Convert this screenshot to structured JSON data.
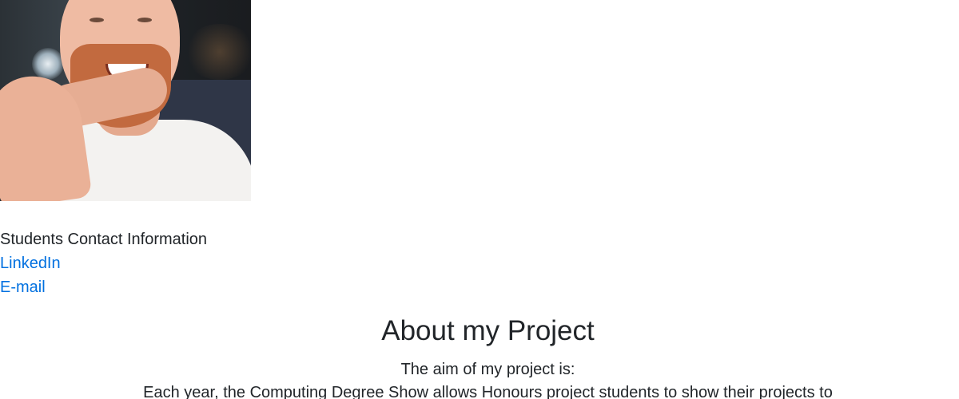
{
  "profile": {
    "photo_alt": "student portrait"
  },
  "contact": {
    "heading": "Students Contact Information",
    "linkedin_label": "LinkedIn",
    "email_label": "E-mail"
  },
  "about": {
    "title": "About my Project",
    "aim_label": "The aim of my project is:",
    "description": "Each year, the Computing Degree Show allows Honours project students to show their projects to"
  },
  "colors": {
    "link": "#0070e0",
    "text": "#212529"
  }
}
